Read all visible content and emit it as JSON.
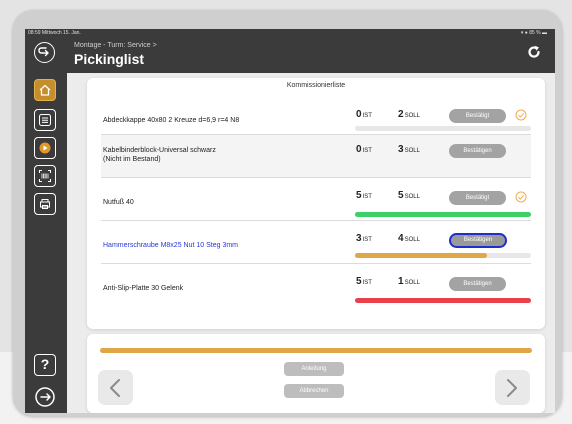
{
  "status_bar": {
    "left": "08:59  Mittwoch 15. Jan.",
    "right": "▾ ● 85 % ▬"
  },
  "header": {
    "subtitle": "Montage - Turm: Service >",
    "title": "Pickinglist"
  },
  "sidebar": {
    "items": [
      "home-icon",
      "list-icon",
      "play-icon",
      "barcode-icon",
      "printer-icon"
    ],
    "help_label": "?"
  },
  "list": {
    "title": "Kommissionierliste",
    "ist_unit": "IST",
    "soll_unit": "SOLL",
    "rows": [
      {
        "name": "Abdeckkappe 40x80 2 Kreuze d=6,9 r=4 N8",
        "ist": "0",
        "soll": "2",
        "button": "Bestätigt",
        "checked": true,
        "progress": 0,
        "bar_color": ""
      },
      {
        "name": "Kabelbinderblock-Universal schwarz",
        "note": "(Nicht im Bestand)",
        "ist": "0",
        "soll": "3",
        "button": "Bestätigen",
        "checked": false,
        "progress": 0,
        "bar_color": ""
      },
      {
        "name": "Nutfuß 40",
        "ist": "5",
        "soll": "5",
        "button": "Bestätigt",
        "checked": true,
        "progress": 1.0,
        "bar_color": "#3dd068"
      },
      {
        "name": "Hammerschraube M8x25 Nut 10 Steg 3mm",
        "ist": "3",
        "soll": "4",
        "button": "Bestätigen",
        "checked": false,
        "highlighted": true,
        "progress": 0.75,
        "bar_color": "#e0a648"
      },
      {
        "name": "Anti-Slip-Platte 30 Gelenk",
        "ist": "5",
        "soll": "1",
        "button": "Bestätigen",
        "checked": false,
        "progress": 1.0,
        "bar_color": "#e8414c"
      }
    ]
  },
  "footer": {
    "overall_progress": 1.0,
    "overall_color": "#e0a648",
    "anleitung_label": "Anleitung",
    "abbrechen_label": "Abbrechen"
  },
  "colors": {
    "accent": "#c58e2c",
    "focus": "#1f2fcf",
    "check": "#f0ad4e"
  }
}
